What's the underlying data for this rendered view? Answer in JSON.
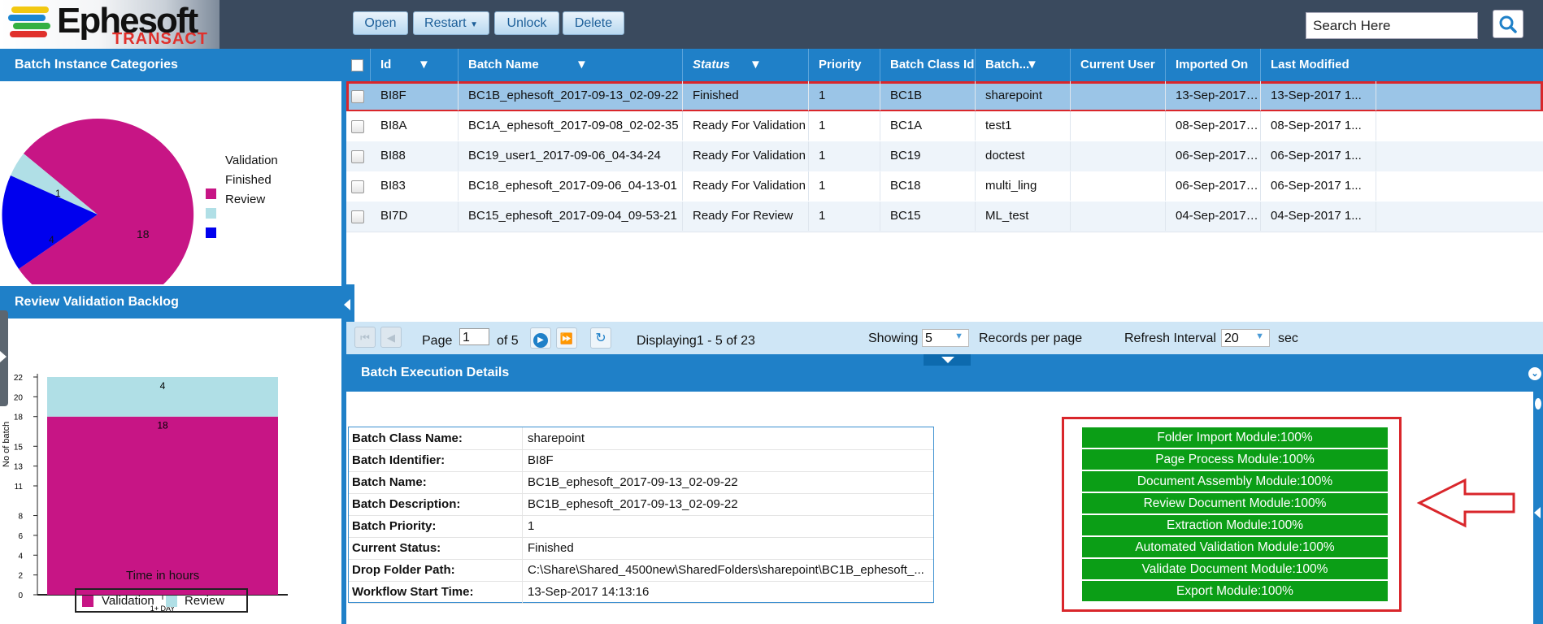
{
  "app": {
    "logo_main": "Ephesoft",
    "logo_sub": "TRANSACT"
  },
  "toolbar": {
    "open": "Open",
    "restart": "Restart",
    "unlock": "Unlock",
    "delete": "Delete"
  },
  "search": {
    "value": "Search Here"
  },
  "left": {
    "categories_title": "Batch Instance Categories",
    "pie": {
      "type": "pie",
      "slices": [
        {
          "name": "Validation",
          "value": 18,
          "color": "#c71585"
        },
        {
          "name": "Finished",
          "value": 1,
          "color": "#b0dfe6"
        },
        {
          "name": "Review",
          "value": 4,
          "color": "#0000ee"
        }
      ]
    },
    "legend": [
      "Validation",
      "Finished",
      "Review"
    ],
    "backlog_title": "Review Validation Backlog"
  },
  "chart_data": {
    "type": "bar",
    "stacked": true,
    "categories": [
      "1+ DAY"
    ],
    "series": [
      {
        "name": "Validation",
        "values": [
          18
        ],
        "color": "#c71585"
      },
      {
        "name": "Review",
        "values": [
          4
        ],
        "color": "#b0dfe6"
      }
    ],
    "yticks": [
      0,
      2,
      4,
      6,
      8,
      11,
      13,
      15,
      18,
      20,
      22
    ],
    "ylim": [
      0,
      22
    ],
    "xlabel": "Time in hours",
    "ylabel": "No of batch",
    "legend": "bottom"
  },
  "grid": {
    "columns": [
      "Id",
      "Batch Name",
      "Status",
      "Priority",
      "Batch Class Id",
      "Batch...",
      "Current User",
      "Imported On",
      "Last Modified"
    ],
    "rows": [
      {
        "id": "BI8F",
        "name": "BC1B_ephesoft_2017-09-13_02-09-22",
        "status": "Finished",
        "priority": "1",
        "class": "BC1B",
        "batch": "sharepoint",
        "user": "",
        "imported": "13-Sep-2017 1...",
        "modified": "13-Sep-2017 1..."
      },
      {
        "id": "BI8A",
        "name": "BC1A_ephesoft_2017-09-08_02-02-35",
        "status": "Ready For Validation",
        "priority": "1",
        "class": "BC1A",
        "batch": "test1",
        "user": "",
        "imported": "08-Sep-2017 1...",
        "modified": "08-Sep-2017 1..."
      },
      {
        "id": "BI88",
        "name": "BC19_user1_2017-09-06_04-34-24",
        "status": "Ready For Validation",
        "priority": "1",
        "class": "BC19",
        "batch": "doctest",
        "user": "",
        "imported": "06-Sep-2017 1...",
        "modified": "06-Sep-2017 1..."
      },
      {
        "id": "BI83",
        "name": "BC18_ephesoft_2017-09-06_04-13-01",
        "status": "Ready For Validation",
        "priority": "1",
        "class": "BC18",
        "batch": "multi_ling",
        "user": "",
        "imported": "06-Sep-2017 1...",
        "modified": "06-Sep-2017 1..."
      },
      {
        "id": "BI7D",
        "name": "BC15_ephesoft_2017-09-04_09-53-21",
        "status": "Ready For Review",
        "priority": "1",
        "class": "BC15",
        "batch": "ML_test",
        "user": "",
        "imported": "04-Sep-2017 0...",
        "modified": "04-Sep-2017 1..."
      }
    ]
  },
  "pager": {
    "page_label": "Page",
    "page_value": "1",
    "of": "of 5",
    "displaying": "Displaying1 - 5 of 23",
    "showing": "Showing",
    "per_page": "5",
    "records_label": "Records per page",
    "refresh_label": "Refresh Interval",
    "refresh_value": "20",
    "sec": "sec"
  },
  "execution": {
    "title": "Batch Execution Details",
    "details": [
      {
        "label": "Batch Class Name:",
        "value": "sharepoint"
      },
      {
        "label": "Batch Identifier:",
        "value": "BI8F"
      },
      {
        "label": "Batch Name:",
        "value": "BC1B_ephesoft_2017-09-13_02-09-22"
      },
      {
        "label": "Batch Description:",
        "value": "BC1B_ephesoft_2017-09-13_02-09-22"
      },
      {
        "label": "Batch Priority:",
        "value": "1"
      },
      {
        "label": "Current Status:",
        "value": "Finished"
      },
      {
        "label": "Drop Folder Path:",
        "value": "C:\\Share\\Shared_4500new\\SharedFolders\\sharepoint\\BC1B_ephesoft_..."
      },
      {
        "label": "Workflow Start Time:",
        "value": "13-Sep-2017 14:13:16"
      }
    ],
    "modules": [
      {
        "label": "Folder Import Module:100%",
        "progress": 100
      },
      {
        "label": "Page Process Module:100%",
        "progress": 100
      },
      {
        "label": "Document Assembly Module:100%",
        "progress": 100
      },
      {
        "label": "Review Document Module:100%",
        "progress": 100
      },
      {
        "label": "Extraction Module:100%",
        "progress": 100
      },
      {
        "label": "Automated Validation Module:100%",
        "progress": 100
      },
      {
        "label": "Validate Document Module:100%",
        "progress": 100
      },
      {
        "label": "Export Module:100%",
        "progress": 100
      }
    ]
  }
}
